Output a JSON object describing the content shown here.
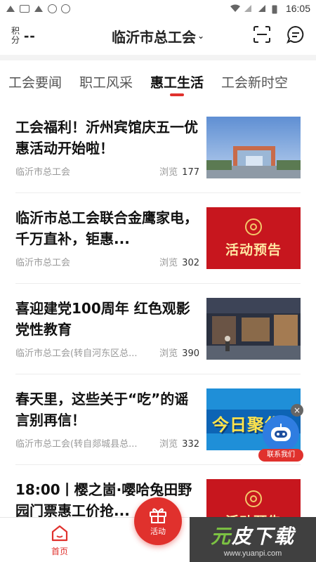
{
  "statusbar": {
    "time": "16:05"
  },
  "header": {
    "points_label": "积分",
    "points_value": "--",
    "city": "临沂市总工会",
    "caret": "⌄"
  },
  "tabs": [
    {
      "label": "工会要闻",
      "active": false
    },
    {
      "label": "职工风采",
      "active": false
    },
    {
      "label": "惠工生活",
      "active": true
    },
    {
      "label": "工会新时空",
      "active": false
    }
  ],
  "articles": [
    {
      "title": "工会福利！沂州宾馆庆五一优惠活动开始啦！",
      "source": "临沂市总工会",
      "views_label": "浏览",
      "views": "177",
      "thumb": "hotel-photo"
    },
    {
      "title": "临沂市总工会联合金鹰家电，千万直补，钜惠...",
      "source": "临沂市总工会",
      "views_label": "浏览",
      "views": "302",
      "thumb": "activity-preview",
      "thumb_text": "活动预告"
    },
    {
      "title": "喜迎建党100周年  红色观影党性教育",
      "source": "临沂市总工会(转自河东区总...",
      "views_label": "浏览",
      "views": "390",
      "thumb": "exhibition-photo"
    },
    {
      "title": "春天里，这些关于“吃”的谣言别再信！",
      "source": "临沂市总工会(转自郯城县总...",
      "views_label": "浏览",
      "views": "332",
      "thumb": "today-news",
      "thumb_text": "今日聚焦"
    },
    {
      "title": "18:00丨樱之崮·嘤哈兔田野园门票惠工价抢...",
      "source": "",
      "views_label": "",
      "views": "",
      "thumb": "activity-preview",
      "thumb_text": "活动预告"
    }
  ],
  "assistant": {
    "label": "联系我们",
    "close": "×"
  },
  "bottom": {
    "home_label": "首页",
    "activity_label": "活动"
  },
  "watermark": {
    "big_a": "元",
    "big_b": "皮下载",
    "small": "www.yuanpi.com"
  },
  "colors": {
    "accent": "#e0312d",
    "promo_red": "#c7161e",
    "bot_blue": "#2f7de1"
  }
}
